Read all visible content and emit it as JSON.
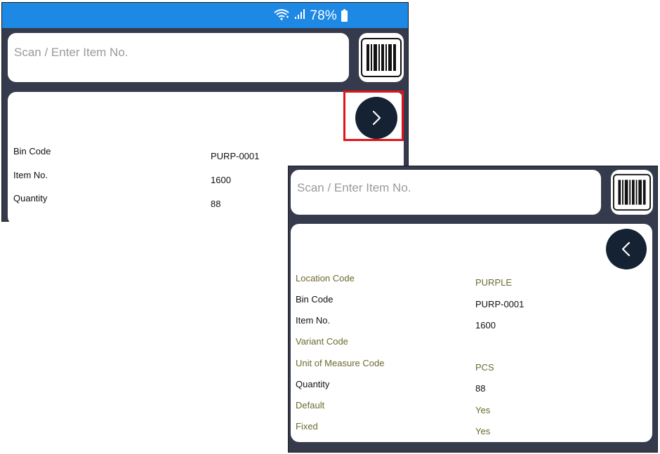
{
  "status_bar": {
    "battery_percent": "78%"
  },
  "screen1": {
    "search_placeholder": "Scan / Enter Item No.",
    "fields": [
      {
        "label": "Bin Code",
        "value": "PURP-0001"
      },
      {
        "label": "Item No.",
        "value": "1600"
      },
      {
        "label": "Quantity",
        "value": "88"
      }
    ]
  },
  "screen2": {
    "search_placeholder": "Scan / Enter Item No.",
    "fields": [
      {
        "label": "Location Code",
        "value": "PURPLE",
        "color": "#6b6a2e"
      },
      {
        "label": "Bin Code",
        "value": "PURP-0001",
        "color": "#111111"
      },
      {
        "label": "Item No.",
        "value": "1600",
        "color": "#111111"
      },
      {
        "label": "Variant Code",
        "value": "",
        "color": "#6b6a2e"
      },
      {
        "label": "Unit of Measure Code",
        "value": "PCS",
        "color": "#6b6a2e"
      },
      {
        "label": "Quantity",
        "value": "88",
        "color": "#111111"
      },
      {
        "label": "Default",
        "value": "Yes",
        "color": "#6b6a2e"
      },
      {
        "label": "Fixed",
        "value": "Yes",
        "color": "#6b6a2e"
      }
    ]
  },
  "icons": {
    "barcode": "barcode-icon",
    "next": "chevron-right-icon",
    "back": "chevron-left-icon",
    "wifi": "wifi-icon",
    "signal": "signal-icon",
    "battery": "battery-icon"
  },
  "colors": {
    "status_bar": "#1e88e5",
    "app_background": "#353a4c",
    "nav_button": "#152233",
    "highlight": "#e0151b",
    "olive_text": "#6b6a2e"
  }
}
